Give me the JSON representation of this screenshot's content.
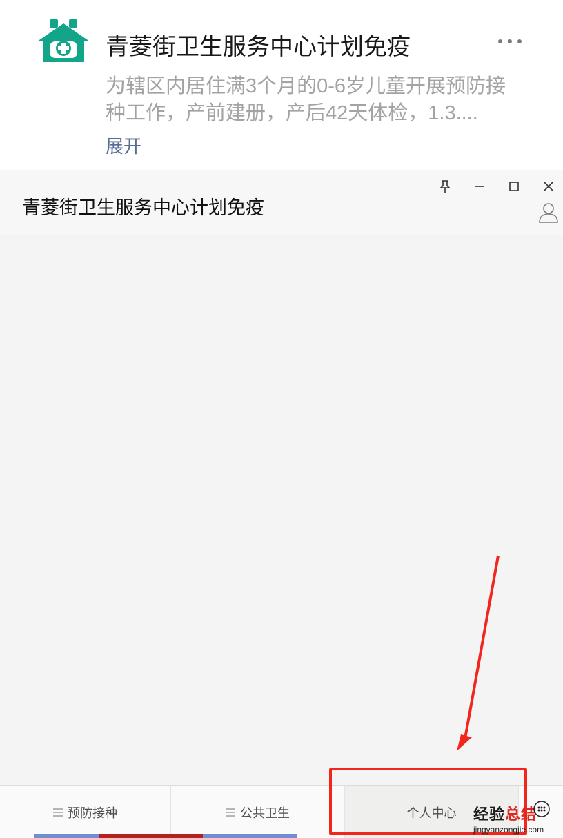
{
  "profile": {
    "name": "青菱街卫生服务中心计划免疫",
    "description": "为辖区内居住满3个月的0-6岁儿童开展预防接种工作，产前建册，产后42天体检，1.3....",
    "expand_label": "展开",
    "logo_icon": "hospital-house-icon",
    "more_icon": "more-dots-icon"
  },
  "window": {
    "title": "青菱街卫生服务中心计划免疫",
    "controls": [
      "pin-icon",
      "minimize-icon",
      "maximize-icon",
      "close-icon"
    ],
    "user_icon": "user-icon"
  },
  "menu": {
    "items": [
      {
        "label": "预防接种",
        "icon": "menu-bars-icon"
      },
      {
        "label": "公共卫生",
        "icon": "menu-bars-icon"
      },
      {
        "label": "个人中心"
      }
    ]
  },
  "watermark": {
    "main_a": "经验",
    "main_b": "总结",
    "sub": "jingyanzongjie.com"
  },
  "colors": {
    "brand_green": "#13a58a",
    "link_blue": "#576b95",
    "annotation_red": "#f2261d"
  }
}
